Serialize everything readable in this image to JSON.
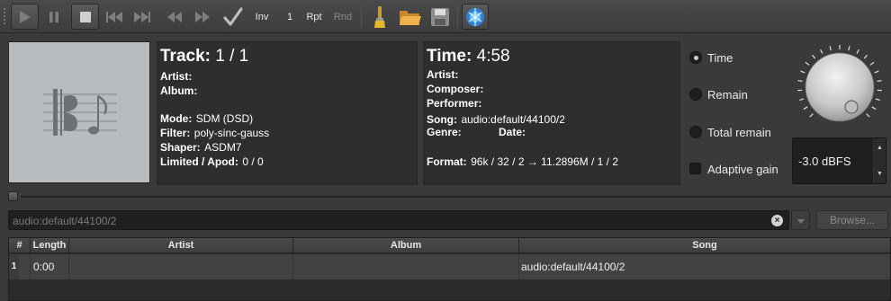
{
  "toolbar": {
    "buttons": [
      {
        "name": "play-icon"
      },
      {
        "name": "pause-icon"
      },
      {
        "name": "stop-icon"
      },
      {
        "name": "previous-track-icon"
      },
      {
        "name": "next-track-icon"
      },
      {
        "name": "rewind-icon"
      },
      {
        "name": "fast-forward-icon"
      },
      {
        "name": "check-icon"
      }
    ],
    "inv_label": "Inv",
    "count_label": "1",
    "repeat_label": "Rpt",
    "random_label": "Rnd",
    "tools": [
      {
        "name": "brush-icon"
      },
      {
        "name": "open-folder-icon"
      },
      {
        "name": "save-icon"
      },
      {
        "name": "network-globe-icon"
      }
    ]
  },
  "track_info": {
    "track_label": "Track:",
    "track_value": "1 / 1",
    "artist_label": "Artist:",
    "artist_value": "",
    "album_label": "Album:",
    "album_value": "",
    "mode_label": "Mode:",
    "mode_value": "SDM (DSD)",
    "filter_label": "Filter:",
    "filter_value": "poly-sinc-gauss",
    "shaper_label": "Shaper:",
    "shaper_value": "ASDM7",
    "limited_label": "Limited / Apod:",
    "limited_value": "0 / 0"
  },
  "time_info": {
    "time_label": "Time:",
    "time_value": "4:58",
    "artist_label": "Artist:",
    "composer_label": "Composer:",
    "performer_label": "Performer:",
    "song_label": "Song:",
    "song_value": "audio:default/44100/2",
    "genre_label": "Genre:",
    "date_label": "Date:",
    "format_label": "Format:",
    "format_value": "96k / 32 / 2 → 11.2896M / 1 / 2"
  },
  "display_options": {
    "time": "Time",
    "remain": "Remain",
    "total_remain": "Total remain",
    "adaptive_gain": "Adaptive gain",
    "selected": "time"
  },
  "volume": {
    "value": "-3.0 dBFS"
  },
  "url_bar": {
    "value": "audio:default/44100/2",
    "browse_label": "Browse..."
  },
  "playlist": {
    "columns": [
      "#",
      "Length",
      "Artist",
      "Album",
      "Song"
    ],
    "rows": [
      {
        "num": "1",
        "length": "0:00",
        "artist": "",
        "album": "",
        "song": "audio:default/44100/2"
      }
    ]
  },
  "colors": {
    "background": "#3a3a3a",
    "panel": "#2e2e2e",
    "cover": "#b7bcbf",
    "row_selected": "#424242",
    "brush_yellow": "#e8b62c",
    "folder_orange": "#e7a33a",
    "globe_blue": "#2f7fd6"
  }
}
